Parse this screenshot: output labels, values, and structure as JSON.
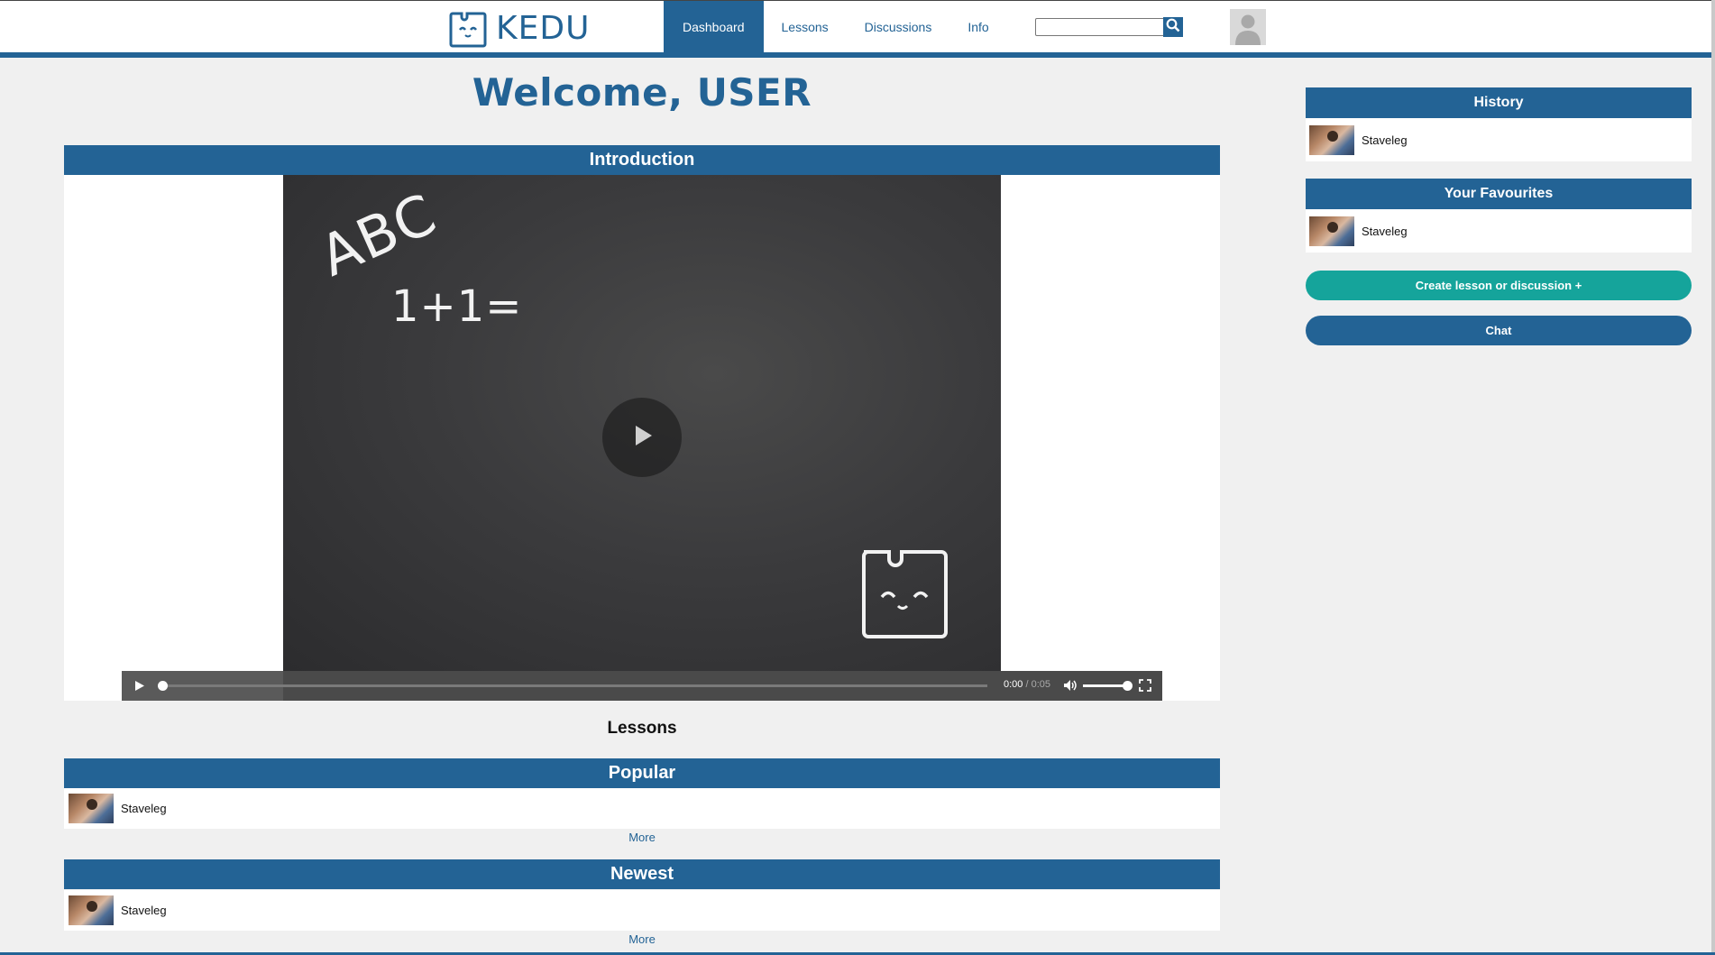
{
  "app": {
    "brand": "KEDU",
    "brand_color": "#236395",
    "logo_icon": "kedu-mascot-icon"
  },
  "nav": {
    "items": [
      {
        "label": "Dashboard",
        "active": true
      },
      {
        "label": "Lessons",
        "active": false
      },
      {
        "label": "Discussions",
        "active": false
      },
      {
        "label": "Info",
        "active": false
      }
    ]
  },
  "search": {
    "value": "",
    "icon": "search-icon"
  },
  "user": {
    "avatar_icon": "user-avatar-icon"
  },
  "main": {
    "welcome": "Welcome, USER",
    "intro": {
      "header": "Introduction",
      "video": {
        "chalk_text_1": "ABC",
        "chalk_text_2": "1+1=",
        "current_time": "0:00",
        "separator": " / ",
        "duration": "0:05",
        "progress": 0,
        "volume": 1.0
      }
    },
    "lessons_title": "Lessons",
    "popular": {
      "header": "Popular",
      "items": [
        {
          "label": "Staveleg"
        }
      ],
      "more": "More"
    },
    "newest": {
      "header": "Newest",
      "items": [
        {
          "label": "Staveleg"
        }
      ],
      "more": "More"
    }
  },
  "sidebar": {
    "history": {
      "header": "History",
      "items": [
        {
          "label": "Staveleg"
        }
      ]
    },
    "favourites": {
      "header": "Your Favourites",
      "items": [
        {
          "label": "Staveleg"
        }
      ]
    },
    "create_button": "Create lesson or discussion +",
    "chat_button": "Chat",
    "teal_color": "#15a49b"
  }
}
